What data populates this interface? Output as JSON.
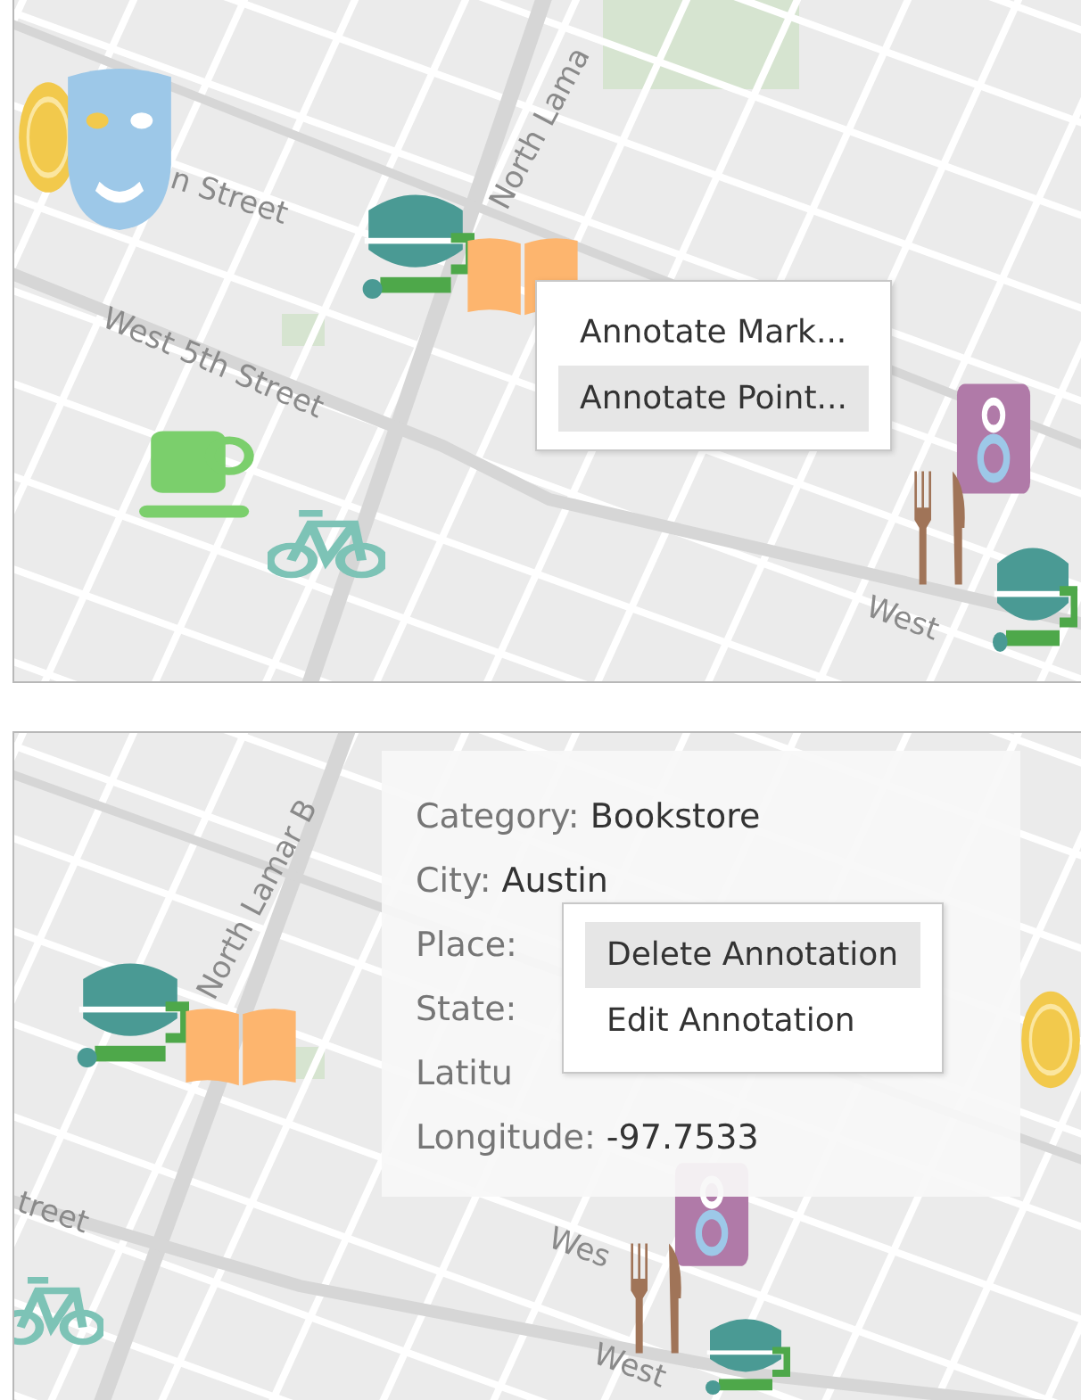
{
  "panels": [
    {
      "streets": [
        "n Street",
        "North Lama",
        "West 5th Street",
        "West"
      ],
      "menu": {
        "items": [
          {
            "label": "Annotate Mark...",
            "selected": false
          },
          {
            "label": "Annotate Point...",
            "selected": true
          }
        ]
      }
    },
    {
      "streets": [
        "North Lamar B",
        "treet",
        "Wes",
        "West"
      ],
      "annotation": {
        "lines": [
          {
            "label": "Category:",
            "value": "Bookstore"
          },
          {
            "label": "City:",
            "value": "Austin"
          },
          {
            "label": "Place:"
          },
          {
            "label": "State:"
          },
          {
            "label": "Latitu"
          },
          {
            "label": "Longitude:",
            "value": "-97.7533"
          }
        ]
      },
      "menu": {
        "items": [
          {
            "label": "Delete Annotation",
            "selected": true
          },
          {
            "label": "Edit Annotation",
            "selected": false
          }
        ]
      }
    }
  ]
}
